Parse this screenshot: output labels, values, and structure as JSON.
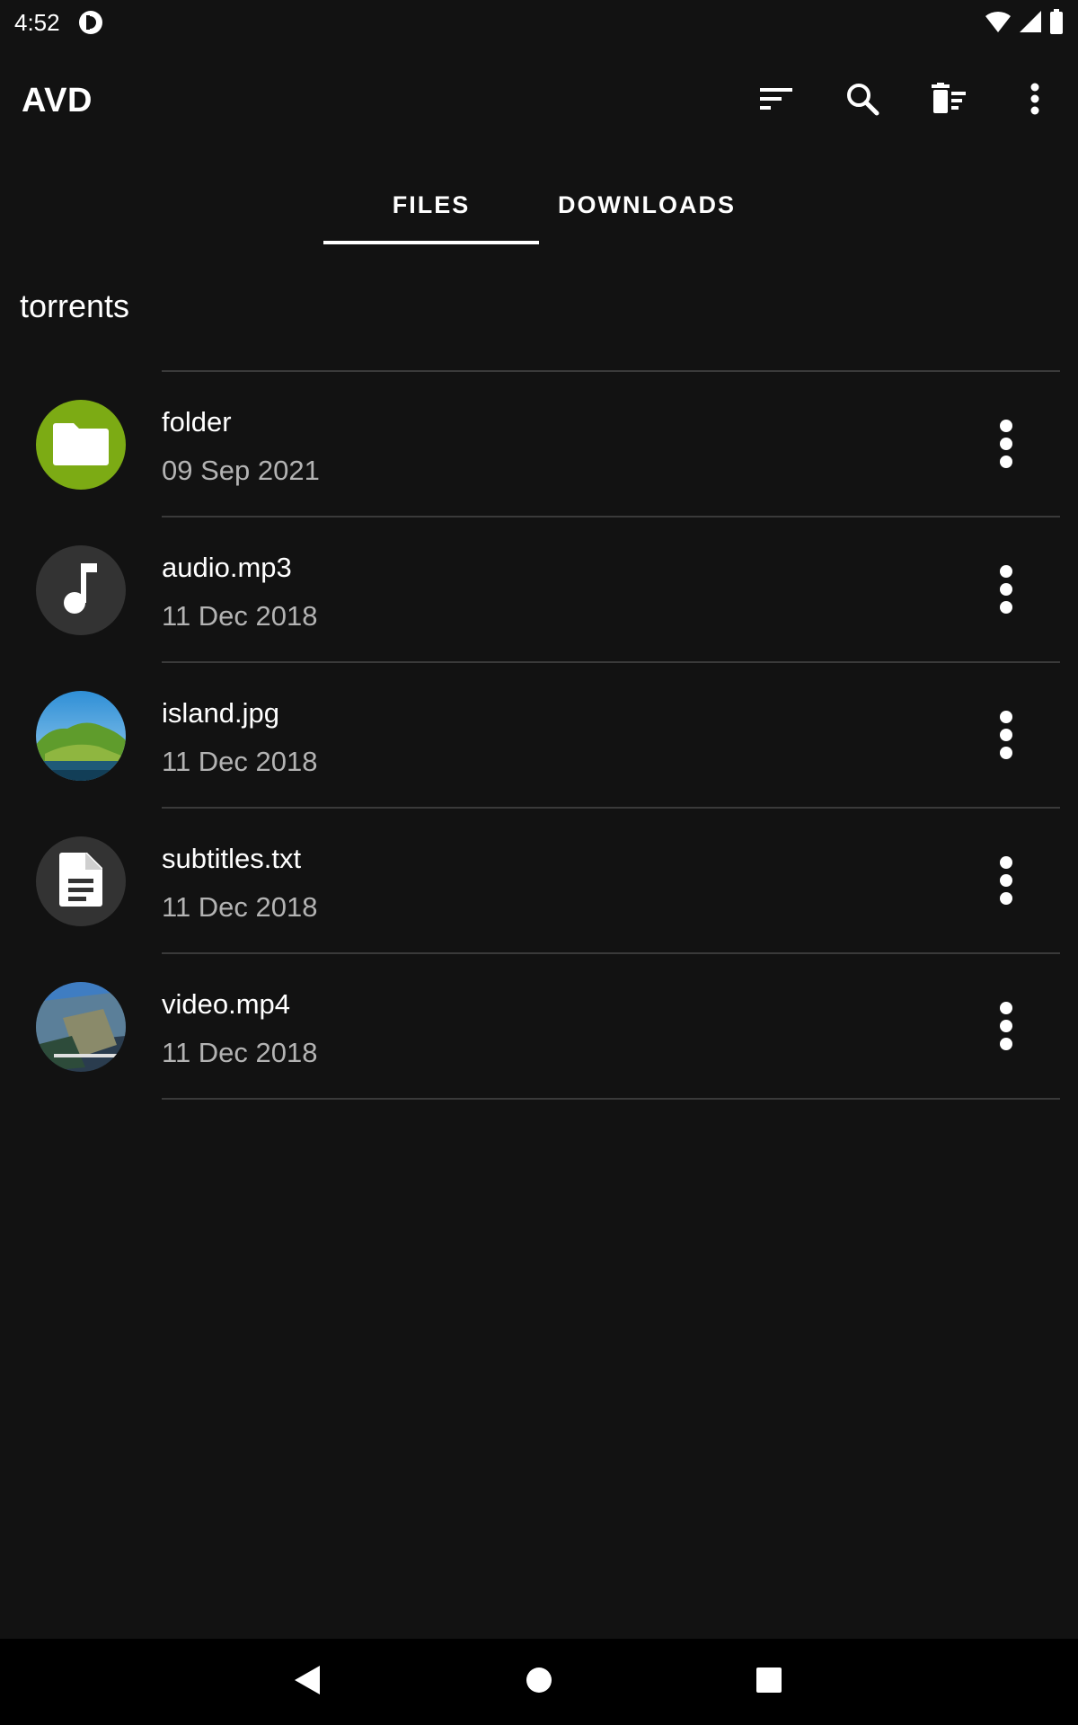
{
  "status_bar": {
    "time": "4:52",
    "icons": [
      "app-notification-icon",
      "wifi-icon",
      "cell-signal-icon",
      "battery-icon"
    ]
  },
  "app_bar": {
    "title": "AVD",
    "actions": [
      "sort-icon",
      "search-icon",
      "delete-sweep-icon",
      "more-vert-icon"
    ]
  },
  "tabs": [
    {
      "label": "FILES",
      "active": true
    },
    {
      "label": "DOWNLOADS",
      "active": false
    }
  ],
  "path_heading": "torrents",
  "files": [
    {
      "name": "folder",
      "date": "09 Sep 2021",
      "icon": "folder-icon",
      "avatar_color": "#7cab14"
    },
    {
      "name": "audio.mp3",
      "date": "11 Dec 2018",
      "icon": "music-note-icon",
      "avatar_color": "#333333"
    },
    {
      "name": "island.jpg",
      "date": "11 Dec 2018",
      "icon": "image-thumbnail",
      "avatar_color": "#3a8fd0"
    },
    {
      "name": "subtitles.txt",
      "date": "11 Dec 2018",
      "icon": "document-icon",
      "avatar_color": "#333333"
    },
    {
      "name": "video.mp4",
      "date": "11 Dec 2018",
      "icon": "video-thumbnail",
      "avatar_color": "#44607a"
    }
  ],
  "nav_bar": {
    "buttons": [
      "back-icon",
      "home-icon",
      "recents-icon"
    ]
  },
  "colors": {
    "background": "#121212",
    "divider": "#3a3a3a",
    "secondary_text": "#b3b3b3",
    "folder_accent": "#7cab14"
  }
}
